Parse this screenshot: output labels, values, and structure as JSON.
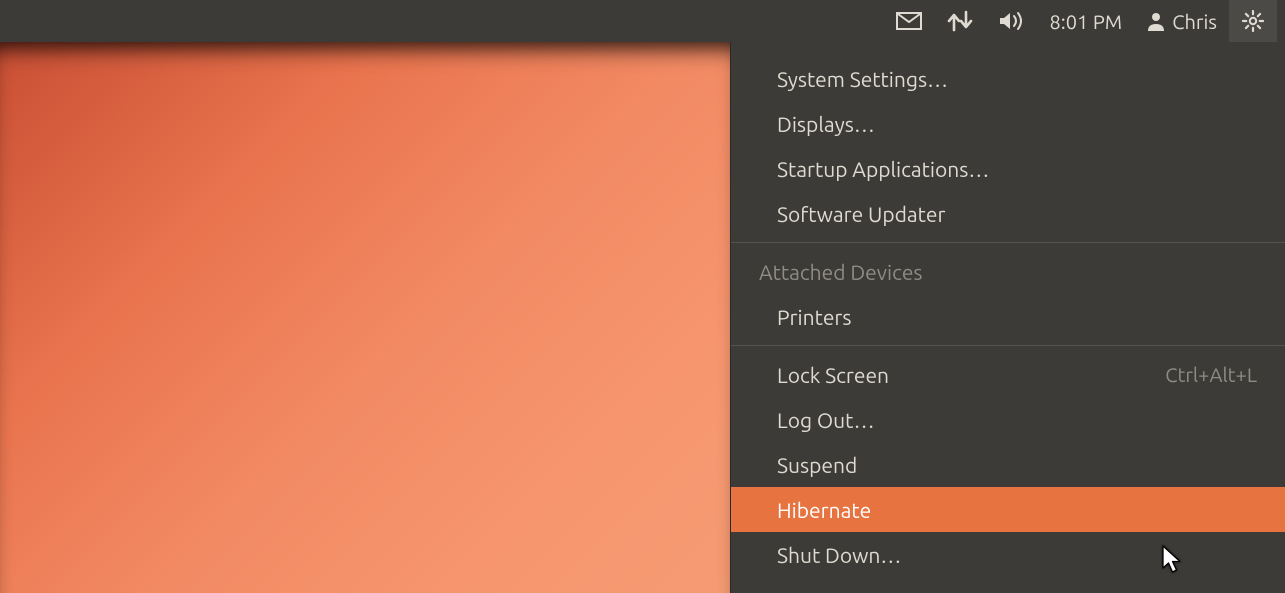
{
  "topbar": {
    "clock": "8:01 PM",
    "user_name": "Chris"
  },
  "menu": {
    "group1": [
      {
        "label": "System Settings…"
      },
      {
        "label": "Displays…"
      },
      {
        "label": "Startup Applications…"
      },
      {
        "label": "Software Updater"
      }
    ],
    "devices_header": "Attached Devices",
    "devices": [
      {
        "label": "Printers"
      }
    ],
    "group2": [
      {
        "label": "Lock Screen",
        "accel": "Ctrl+Alt+L"
      },
      {
        "label": "Log Out…"
      },
      {
        "label": "Suspend"
      },
      {
        "label": "Hibernate",
        "highlight": true
      },
      {
        "label": "Shut Down…"
      }
    ]
  }
}
